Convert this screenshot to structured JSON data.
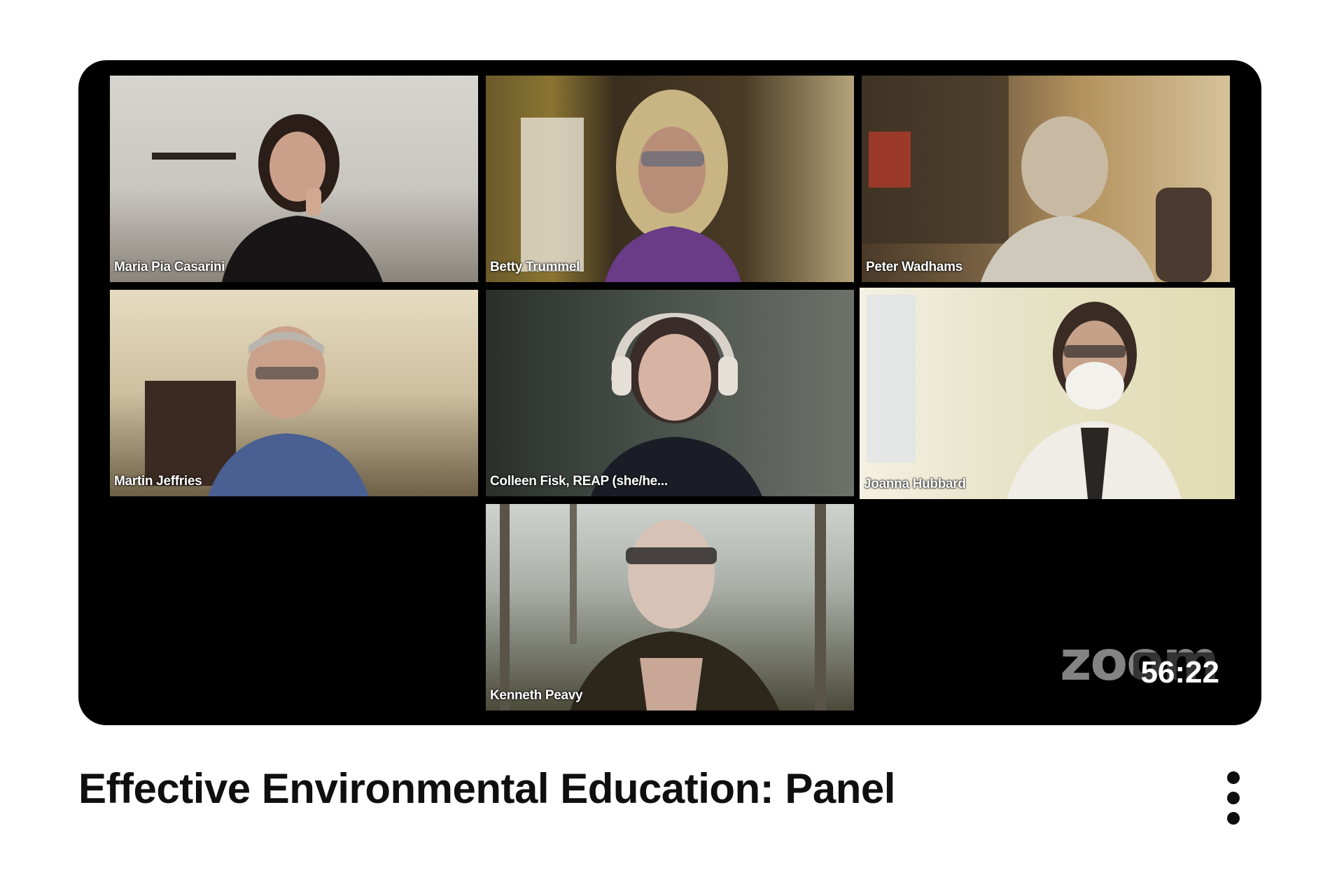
{
  "video": {
    "title": "Effective Environmental Education: Panel",
    "duration": "56:22",
    "watermark": "zoom",
    "participants": [
      {
        "name": "Maria Pia Casarini",
        "active": false
      },
      {
        "name": "Betty Trummel",
        "active": false
      },
      {
        "name": "Peter Wadhams",
        "active": false
      },
      {
        "name": "Martin Jeffries",
        "active": false
      },
      {
        "name": "Colleen Fisk, REAP (she/he...",
        "active": false
      },
      {
        "name": "Joanna Hubbard",
        "active": true
      },
      {
        "name": "Kenneth Peavy",
        "active": false
      }
    ]
  },
  "menu": {
    "icon": "more-vert-icon"
  },
  "colors": {
    "active_speaker": "#8bd13a",
    "thumbnail_bg": "#000000",
    "title_text": "#0f0f0f"
  }
}
